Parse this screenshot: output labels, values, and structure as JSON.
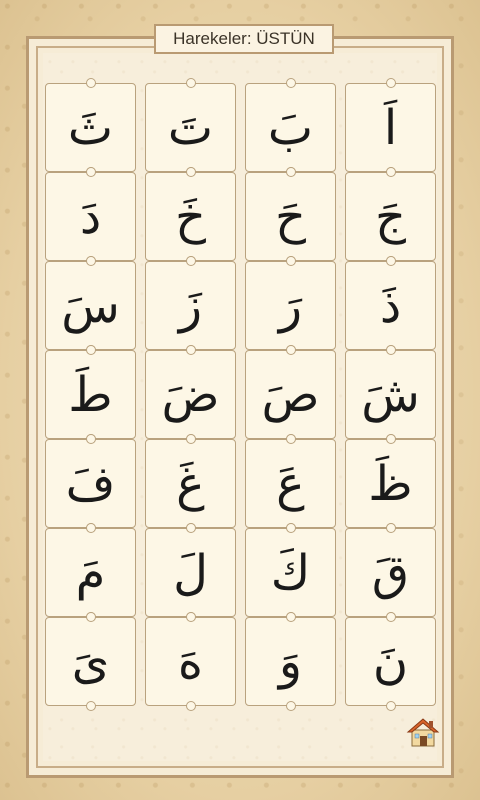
{
  "header": {
    "title": "Harekeler: ÜSTÜN"
  },
  "rows": [
    [
      "ثَ",
      "تَ",
      "بَ",
      "اَ"
    ],
    [
      "دَ",
      "خَ",
      "حَ",
      "جَ"
    ],
    [
      "سَ",
      "زَ",
      "رَ",
      "ذَ"
    ],
    [
      "طَ",
      "ضَ",
      "صَ",
      "شَ"
    ],
    [
      "فَ",
      "غَ",
      "عَ",
      "ظَ"
    ],
    [
      "مَ",
      "لَ",
      "كَ",
      "قَ"
    ],
    [
      "ىَ",
      "هَ",
      "وَ",
      "نَ"
    ]
  ],
  "icons": {
    "home": "home-icon"
  },
  "colors": {
    "harake": "#d0312d",
    "frame": "#b99a72",
    "tile": "#fdf7e6"
  }
}
